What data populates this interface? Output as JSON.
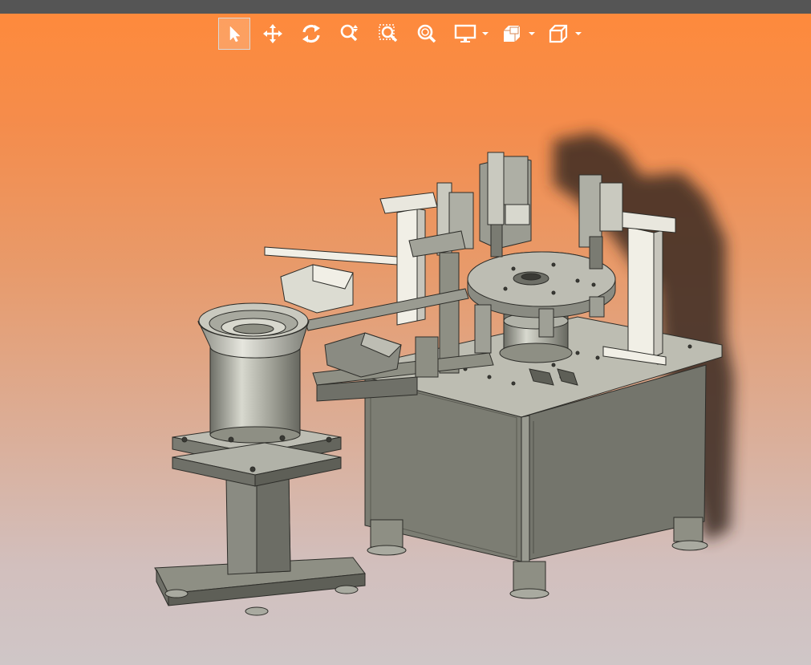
{
  "toolbar": {
    "tools": [
      {
        "id": "select",
        "icon": "select-arrow-icon",
        "active": true
      },
      {
        "id": "pan",
        "icon": "pan-move-icon",
        "active": false
      },
      {
        "id": "rotate",
        "icon": "rotate-icon",
        "active": false
      },
      {
        "id": "zoom",
        "icon": "zoom-icon",
        "active": false
      },
      {
        "id": "zoom-window",
        "icon": "zoom-window-icon",
        "active": false
      },
      {
        "id": "zoom-fit",
        "icon": "zoom-fit-icon",
        "active": false
      },
      {
        "id": "display-mode",
        "icon": "display-monitor-icon",
        "has_dropdown": true
      },
      {
        "id": "section",
        "icon": "section-view-icon",
        "has_dropdown": true
      },
      {
        "id": "view-orientation",
        "icon": "view-cube-icon",
        "has_dropdown": true
      }
    ]
  },
  "viewport": {
    "model": "assembly-machine-3d-model",
    "colors": {
      "background_top": "#ff8a3a",
      "background_bottom": "#cfc6c7",
      "model_body": "#8e8f84",
      "model_dark": "#5e5f57",
      "model_light": "#cfcfc4",
      "accent_white": "#f1efe6",
      "shadow": "#3a2a22"
    }
  }
}
